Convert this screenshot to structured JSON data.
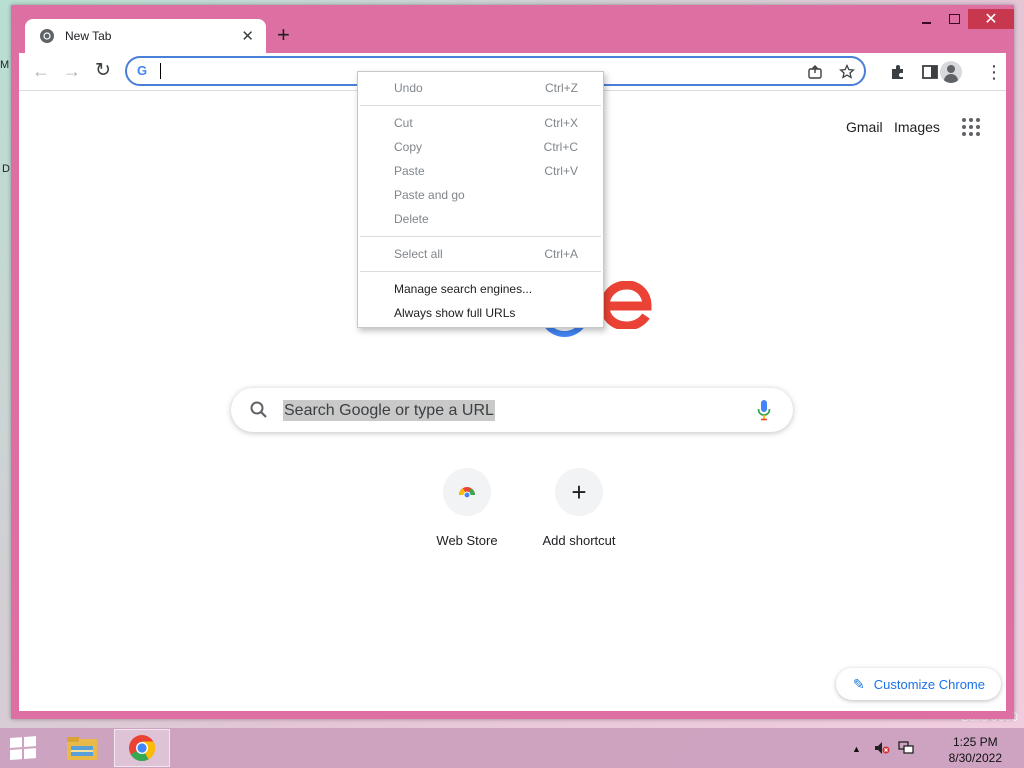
{
  "desktop": {
    "left_fragment_1": "M",
    "left_fragment_2": "D",
    "watermark": "Build 9600"
  },
  "window": {
    "minimize_label": "",
    "maximize_label": "",
    "close_label": "✕"
  },
  "tab": {
    "title": "New Tab",
    "close": "✕",
    "new_tab": "+"
  },
  "toolbar": {
    "back": "←",
    "forward": "→",
    "reload": "↻",
    "omnibox_value": "",
    "share_icon": "share-icon",
    "star_icon": "star-icon",
    "extensions_icon": "puzzle-icon",
    "sidepanel_icon": "side-panel-icon",
    "menu": "⋮"
  },
  "ntp": {
    "gmail": "Gmail",
    "images": "Images",
    "search_placeholder": "Search Google or type a URL",
    "shortcuts": [
      {
        "label": "Web Store",
        "icon": "web-store-icon"
      },
      {
        "label": "Add shortcut",
        "icon": "+"
      }
    ],
    "customize": "Customize Chrome"
  },
  "context_menu": {
    "items": [
      {
        "label": "Undo",
        "shortcut": "Ctrl+Z",
        "enabled": false
      },
      {
        "label": "Cut",
        "shortcut": "Ctrl+X",
        "enabled": false
      },
      {
        "label": "Copy",
        "shortcut": "Ctrl+C",
        "enabled": false
      },
      {
        "label": "Paste",
        "shortcut": "Ctrl+V",
        "enabled": false
      },
      {
        "label": "Paste and go",
        "shortcut": "",
        "enabled": false
      },
      {
        "label": "Delete",
        "shortcut": "",
        "enabled": false
      },
      {
        "label": "Select all",
        "shortcut": "Ctrl+A",
        "enabled": false
      },
      {
        "label": "Manage search engines...",
        "shortcut": "",
        "enabled": true
      },
      {
        "label": "Always show full URLs",
        "shortcut": "",
        "enabled": true
      }
    ]
  },
  "taskbar": {
    "time": "1:25 PM",
    "date": "8/30/2022"
  },
  "colors": {
    "window_frame": "#dd6fa3",
    "accent_blue": "#1a73e8",
    "close_red": "#c7374e",
    "logo_red": "#ea4335",
    "logo_blue": "#4285f4"
  }
}
